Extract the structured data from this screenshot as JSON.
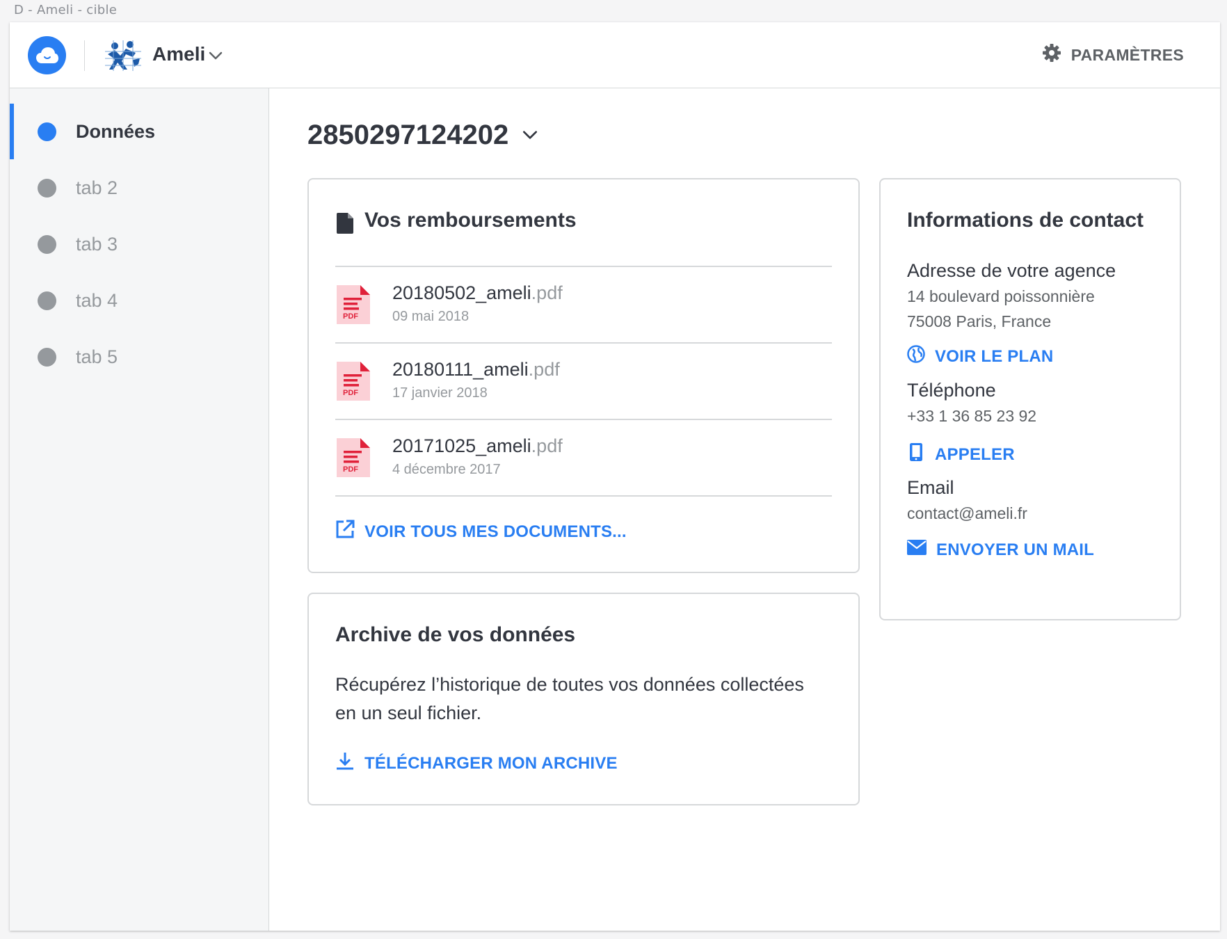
{
  "window": {
    "title": "D - Ameli - cible"
  },
  "header": {
    "app_name": "Ameli",
    "settings_label": "PARAMÈTRES"
  },
  "sidebar": {
    "items": [
      {
        "label": "Données",
        "active": true
      },
      {
        "label": "tab 2",
        "active": false
      },
      {
        "label": "tab 3",
        "active": false
      },
      {
        "label": "tab 4",
        "active": false
      },
      {
        "label": "tab 5",
        "active": false
      }
    ]
  },
  "main": {
    "account_number": "2850297124202"
  },
  "reimbursements": {
    "title": "Vos remboursements",
    "files": [
      {
        "name": "20180502_ameli",
        "ext": ".pdf",
        "date": "09 mai 2018",
        "badge": "PDF"
      },
      {
        "name": "20180111_ameli",
        "ext": ".pdf",
        "date": "17 janvier 2018",
        "badge": "PDF"
      },
      {
        "name": "20171025_ameli",
        "ext": ".pdf",
        "date": "4 décembre 2017",
        "badge": "PDF"
      }
    ],
    "all_docs_link": "VOIR TOUS MES DOCUMENTS..."
  },
  "archive": {
    "title": "Archive de vos données",
    "description": "Récupérez l’historique de toutes vos données collectées en un seul fichier.",
    "download_link": "TÉLÉCHARGER MON ARCHIVE"
  },
  "contact": {
    "title": "Informations de contact",
    "address_label": "Adresse de votre agence",
    "address_line1": "14 boulevard poissonnière",
    "address_line2": "75008 Paris, France",
    "map_link": "VOIR LE PLAN",
    "phone_label": "Téléphone",
    "phone_value": "+33 1 36 85 23 92",
    "call_link": "APPELER",
    "email_label": "Email",
    "email_value": "contact@ameli.fr",
    "mail_link": "ENVOYER UN MAIL"
  },
  "colors": {
    "accent": "#297ef2",
    "text": "#32363f",
    "muted": "#95999d",
    "pdf_red": "#e0213a",
    "pdf_bg": "#fbd0d6"
  }
}
